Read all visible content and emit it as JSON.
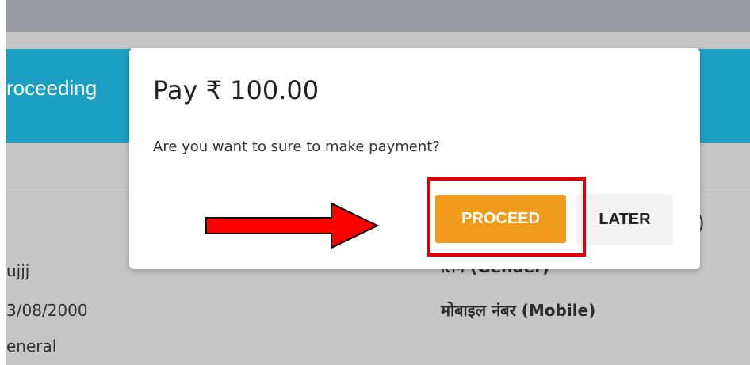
{
  "background": {
    "section_title": "roceeding",
    "fields": [
      {
        "value": "ujjj"
      },
      {
        "value": "3/08/2000"
      },
      {
        "value": "eneral"
      }
    ],
    "labels": [
      {
        "text": "लिंग (Gender)"
      },
      {
        "text": "मोबाइल नंबर (Mobile)"
      }
    ],
    "paren_fragment": ")"
  },
  "dialog": {
    "title": "Pay ₹ 100.00",
    "message": "Are you want to sure to make payment?",
    "proceed_label": "PROCEED",
    "later_label": "LATER"
  },
  "colors": {
    "accent_blue": "#1ba0c3",
    "proceed_orange": "#f09a1b",
    "highlight_red": "#e00000"
  },
  "annotations": {
    "arrow_icon": "right-arrow-icon",
    "highlight_box": "red-rectangle"
  }
}
